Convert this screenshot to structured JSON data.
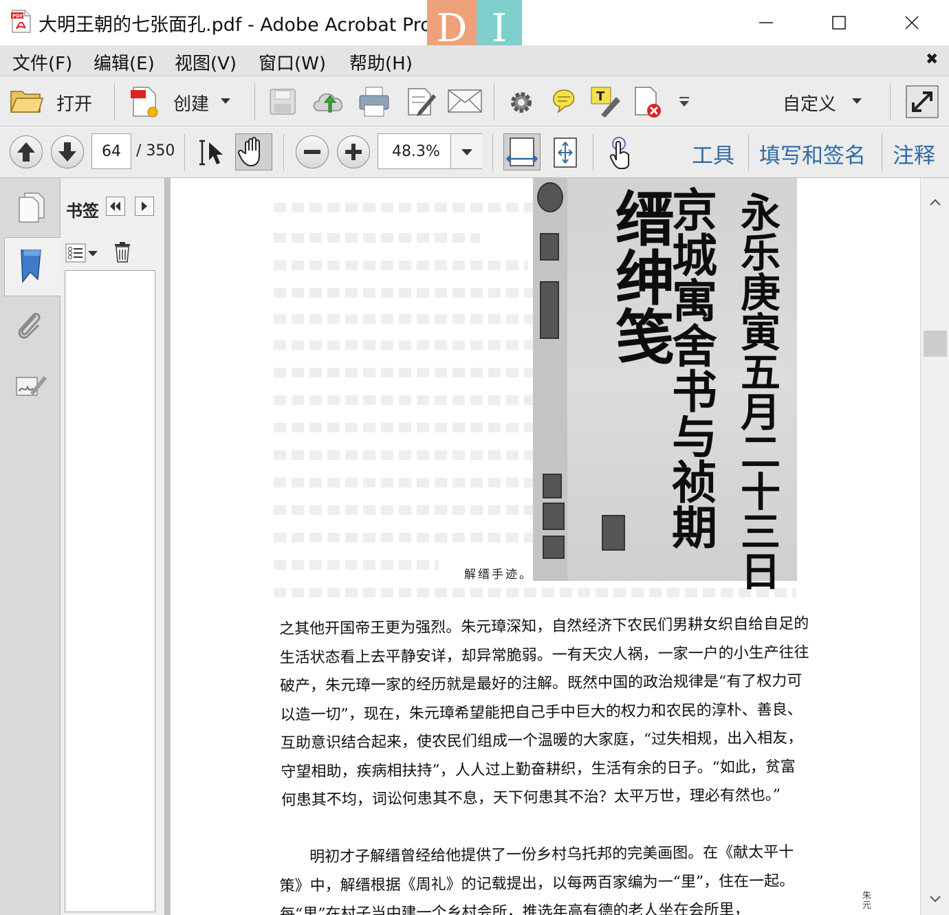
{
  "window": {
    "title": "大明王朝的七张面孔.pdf - Adobe Acrobat Pro",
    "overlay_letters": [
      "D",
      "I"
    ]
  },
  "menu": {
    "items": [
      "文件(F)",
      "编辑(E)",
      "视图(V)",
      "窗口(W)",
      "帮助(H)"
    ],
    "close_glyph": "✖"
  },
  "toolbar": {
    "open_label": "打开",
    "create_label": "创建",
    "customize_label": "自定义"
  },
  "nav": {
    "current_page": "64",
    "total_pages": "/ 350",
    "zoom": "48.3%"
  },
  "panes": {
    "tools": "工具",
    "fill_sign": "填写和签名",
    "comment": "注释"
  },
  "bookmarks": {
    "title": "书签"
  },
  "document": {
    "calligraphy_columns": [
      "永乐庚寅五月二十三日",
      "京城寓舍书与祯期",
      "缙绅笺"
    ],
    "caption": "解缙手迹。",
    "paragraphs": [
      "之其他开国帝王更为强烈。朱元璋深知，自然经济下农民们男耕女织自给自足的生活状态看上去平静安详，却异常脆弱。一有天灾人祸，一家一户的小生产往往破产，朱元璋一家的经历就是最好的注解。既然中国的政治规律是“有了权力可以造一切”，现在，朱元璋希望能把自己手中巨大的权力和农民的淳朴、善良、互助意识结合起来，使农民们组成一个温暖的大家庭，“过失相规，出入相友，守望相助，疾病相扶持”，人人过上勤奋耕织，生活有余的日子。“如此，贫富何患其不均，词讼何患其不息，天下何患其不治？太平万世，理必有然也。”",
      "明初才子解缙曾经给他提供了一份乡村乌托邦的完美画图。在《献太平十策》中，解缙根据《周礼》的记载提出，以每两百家编为一“里”，住在一起。每“里”在村子当中建一个乡村会所，推选年高有德的老人坐在会所里，"
    ],
    "side_note": "朱元"
  }
}
